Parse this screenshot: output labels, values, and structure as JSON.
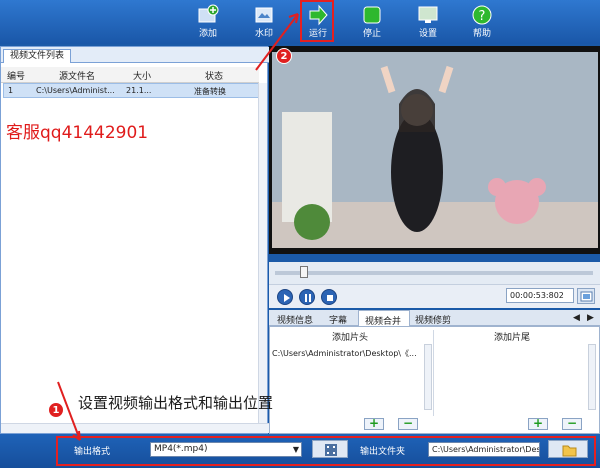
{
  "toolbar": {
    "items": [
      {
        "label": "添加",
        "icon": "add-video-icon"
      },
      {
        "label": "水印",
        "icon": "watermark-icon"
      },
      {
        "label": "运行",
        "icon": "run-arrow-icon"
      },
      {
        "label": "停止",
        "icon": "stop-icon"
      },
      {
        "label": "设置",
        "icon": "settings-monitor-icon"
      },
      {
        "label": "帮助",
        "icon": "help-icon"
      }
    ]
  },
  "file_list": {
    "tab": "视频文件列表",
    "columns": [
      "编号",
      "源文件名",
      "大小",
      "状态"
    ],
    "rows": [
      {
        "num": "1",
        "name": "C:\\Users\\Administ...",
        "size": "21.1...",
        "status": "准备转换"
      }
    ]
  },
  "watermark_text": "客服qq41442901",
  "player": {
    "time": "00:00:53:802"
  },
  "detail_tabs": [
    "视频信息",
    "字幕",
    "视频合并",
    "视频修剪"
  ],
  "merge": {
    "head_label": "添加片头",
    "tail_label": "添加片尾",
    "head_item": "C:\\Users\\Administrator\\Desktop\\《..."
  },
  "bottom": {
    "format_label": "输出格式",
    "format_value": "MP4(*.mp4)",
    "folder_label": "输出文件夹",
    "folder_value": "C:\\Users\\Administrator\\Des"
  },
  "annotations": {
    "badge1": "1",
    "badge2": "2",
    "note": "设置视频输出格式和输出位置"
  },
  "colors": {
    "accent_blue": "#1a57a8",
    "highlight_red": "#e52020"
  }
}
